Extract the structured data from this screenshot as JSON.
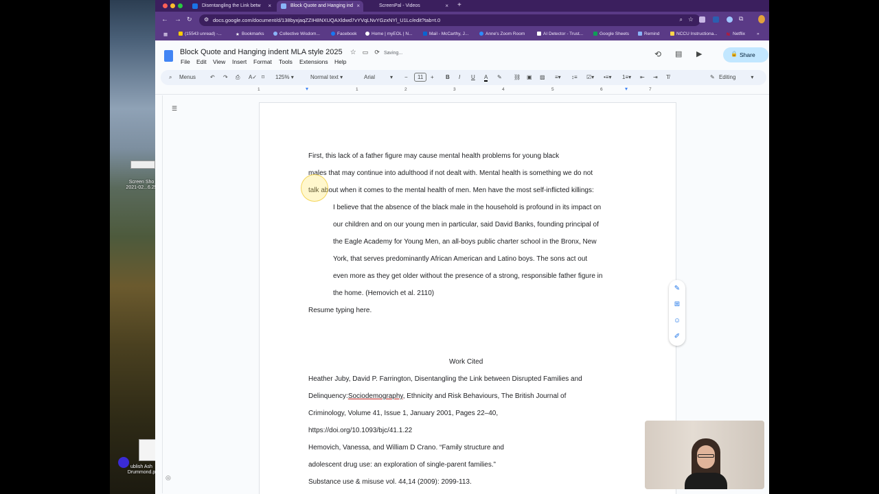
{
  "desktop": {
    "item1_label": "Screen Sho\n2021-02...6.25",
    "item2_label": "ublish Ash\nDrummond.p"
  },
  "tabs": [
    {
      "title": "Disentangling the Link betw",
      "color": "#1a73e8"
    },
    {
      "title": "Block Quote and Hanging ind",
      "color": "#4285f4"
    },
    {
      "title": "ScreenPal - Videos",
      "color": "#5a3a86"
    }
  ],
  "address": {
    "url": "docs.google.com/document/d/138byxjaqZZIH8NXUQAXldwd7vYVqLNvYGzxNYl_U1Lc/edit?tab=t.0"
  },
  "bookmarks": [
    "(15543 unread) -...",
    "Bookmarks",
    "Collective Wisdom...",
    "Facebook",
    "Home | myEOL | N...",
    "Mail - McCarthy, J...",
    "Anne's Zoom Room",
    "AI Detector - Trust...",
    "Google Sheets",
    "Remind",
    "NCCU Instructiona...",
    "Netflix"
  ],
  "doc": {
    "title": "Block Quote and Hanging indent MLA style 2025",
    "status": "Saving...",
    "menus": [
      "File",
      "Edit",
      "View",
      "Insert",
      "Format",
      "Tools",
      "Extensions",
      "Help"
    ],
    "share_label": "Share"
  },
  "toolbar": {
    "search": "Menus",
    "zoom": "125%",
    "style": "Normal text",
    "font": "Arial",
    "size": "11",
    "mode": "Editing"
  },
  "ruler": {
    "numbers": [
      "1",
      "1",
      "2",
      "3",
      "4",
      "5",
      "6",
      "7"
    ]
  },
  "body": {
    "p1": [
      "First, this lack of a father figure may cause mental health problems for young black",
      "males that may continue into adulthood if not dealt with. Mental health is something we do not",
      "talk about when it comes to the mental health of men. Men have the most self-inflicted killings:"
    ],
    "quote": [
      "I believe that the absence of the black male in the household is profound in its impact on",
      "our children and on our young men in particular, said David Banks, founding principal of",
      "the Eagle Academy for Young Men, an all-boys public charter school in the Bronx, New",
      "York, that serves predominantly African American and Latino boys. The sons act out",
      "even more as they get older without the presence of a strong, responsible father figure in",
      "the home. (Hemovich et al. 2110)"
    ],
    "resume": "Resume typing here.",
    "works_cited_heading": "Work Cited",
    "citations": [
      "Heather Juby, David P. Farrington, Disentangling the Link between Disrupted Families and",
      "Delinquency:",
      "Sociodemography",
      ", Ethnicity and Risk Behaviours, The British Journal of",
      "Criminology, Volume 41, Issue 1, January 2001, Pages 22–40,",
      "https://doi.org/10.1093/bjc/41.1.22",
      "Hemovich, Vanessa, and William D Crano. “Family structure and",
      "adolescent drug use: an exploration of single-parent families.”",
      "Substance use & misuse vol. 44,14 (2009): 2099-113."
    ]
  }
}
